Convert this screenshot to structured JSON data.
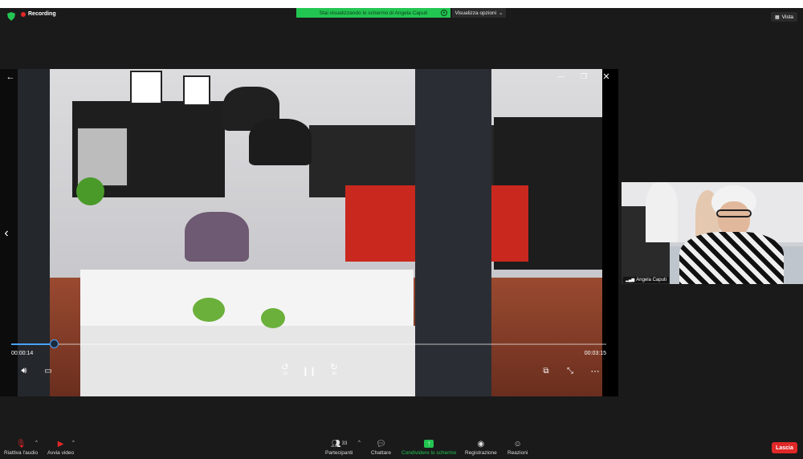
{
  "app": {
    "recording_label": "Recording",
    "view_button_label": "Vista"
  },
  "share_banner": {
    "text": "Stai visualizzando lo schermo di Angela Caputi",
    "options_label": "Visualizza opzioni"
  },
  "player": {
    "current_time": "00:00:14",
    "duration": "00:03:15",
    "progress_fraction": 0.072,
    "rewind_seconds": "10",
    "forward_seconds": "30"
  },
  "participant": {
    "name": "Angela Caputi"
  },
  "toolbar": {
    "audio_label": "Riattiva l'audio",
    "video_label": "Avvia video",
    "participants_label": "Partecipanti",
    "participants_count": "33",
    "chat_label": "Chattare",
    "share_label": "Condividere lo schermo",
    "record_label": "Registrazione",
    "reactions_label": "Reazioni",
    "leave_label": "Lascia"
  },
  "colors": {
    "accent_green": "#23c552",
    "leave_red": "#e02828",
    "progress_blue": "#4aa3ff"
  },
  "icons": [
    "shield-icon",
    "recording-dot-icon",
    "back-arrow-icon",
    "minimize-icon",
    "restore-icon",
    "close-icon",
    "prev-chevron-icon",
    "volume-icon",
    "subtitles-icon",
    "rewind-icon",
    "pause-icon",
    "forward-icon",
    "pip-icon",
    "collapse-icon",
    "more-icon",
    "mic-muted-icon",
    "video-off-icon",
    "participants-icon",
    "chat-icon",
    "share-screen-icon",
    "record-icon",
    "reactions-icon"
  ]
}
